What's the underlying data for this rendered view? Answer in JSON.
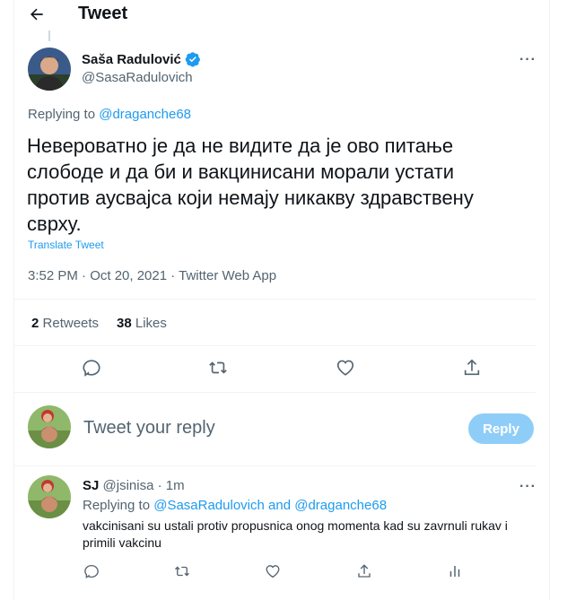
{
  "header": {
    "title": "Tweet"
  },
  "tweet": {
    "author_name": "Saša Radulović",
    "author_handle": "@SasaRadulovich",
    "replying_prefix": "Replying to",
    "replying_to": "@draganche68",
    "text": "Невероватно је да не видите да је ово питање слободе и да би и вакцинисани морали устати против аусвајса који немају никакву здравствену сврху.",
    "translate": "Translate Tweet",
    "timestamp": "3:52 PM · Oct 20, 2021 · Twitter Web App",
    "retweets_count": "2",
    "retweets_label": "Retweets",
    "likes_count": "38",
    "likes_label": "Likes"
  },
  "composer": {
    "placeholder": "Tweet your reply",
    "button_label": "Reply"
  },
  "reply": {
    "author_name": "SJ",
    "author_handle": "@jsinisa",
    "time": "· 1m",
    "replying_prefix": "Replying to",
    "replying_to_1": "@SasaRadulovich",
    "replying_and": "and",
    "replying_to_2": "@draganche68",
    "text": "vakcinisani su ustali protiv propusnica onog momenta kad su zavrnuli rukav i primili vakcinu"
  },
  "colors": {
    "accent": "#1d9bf0",
    "reply_button": "#8ecdf8",
    "muted": "#536471",
    "verified": "#1d9bf0"
  }
}
